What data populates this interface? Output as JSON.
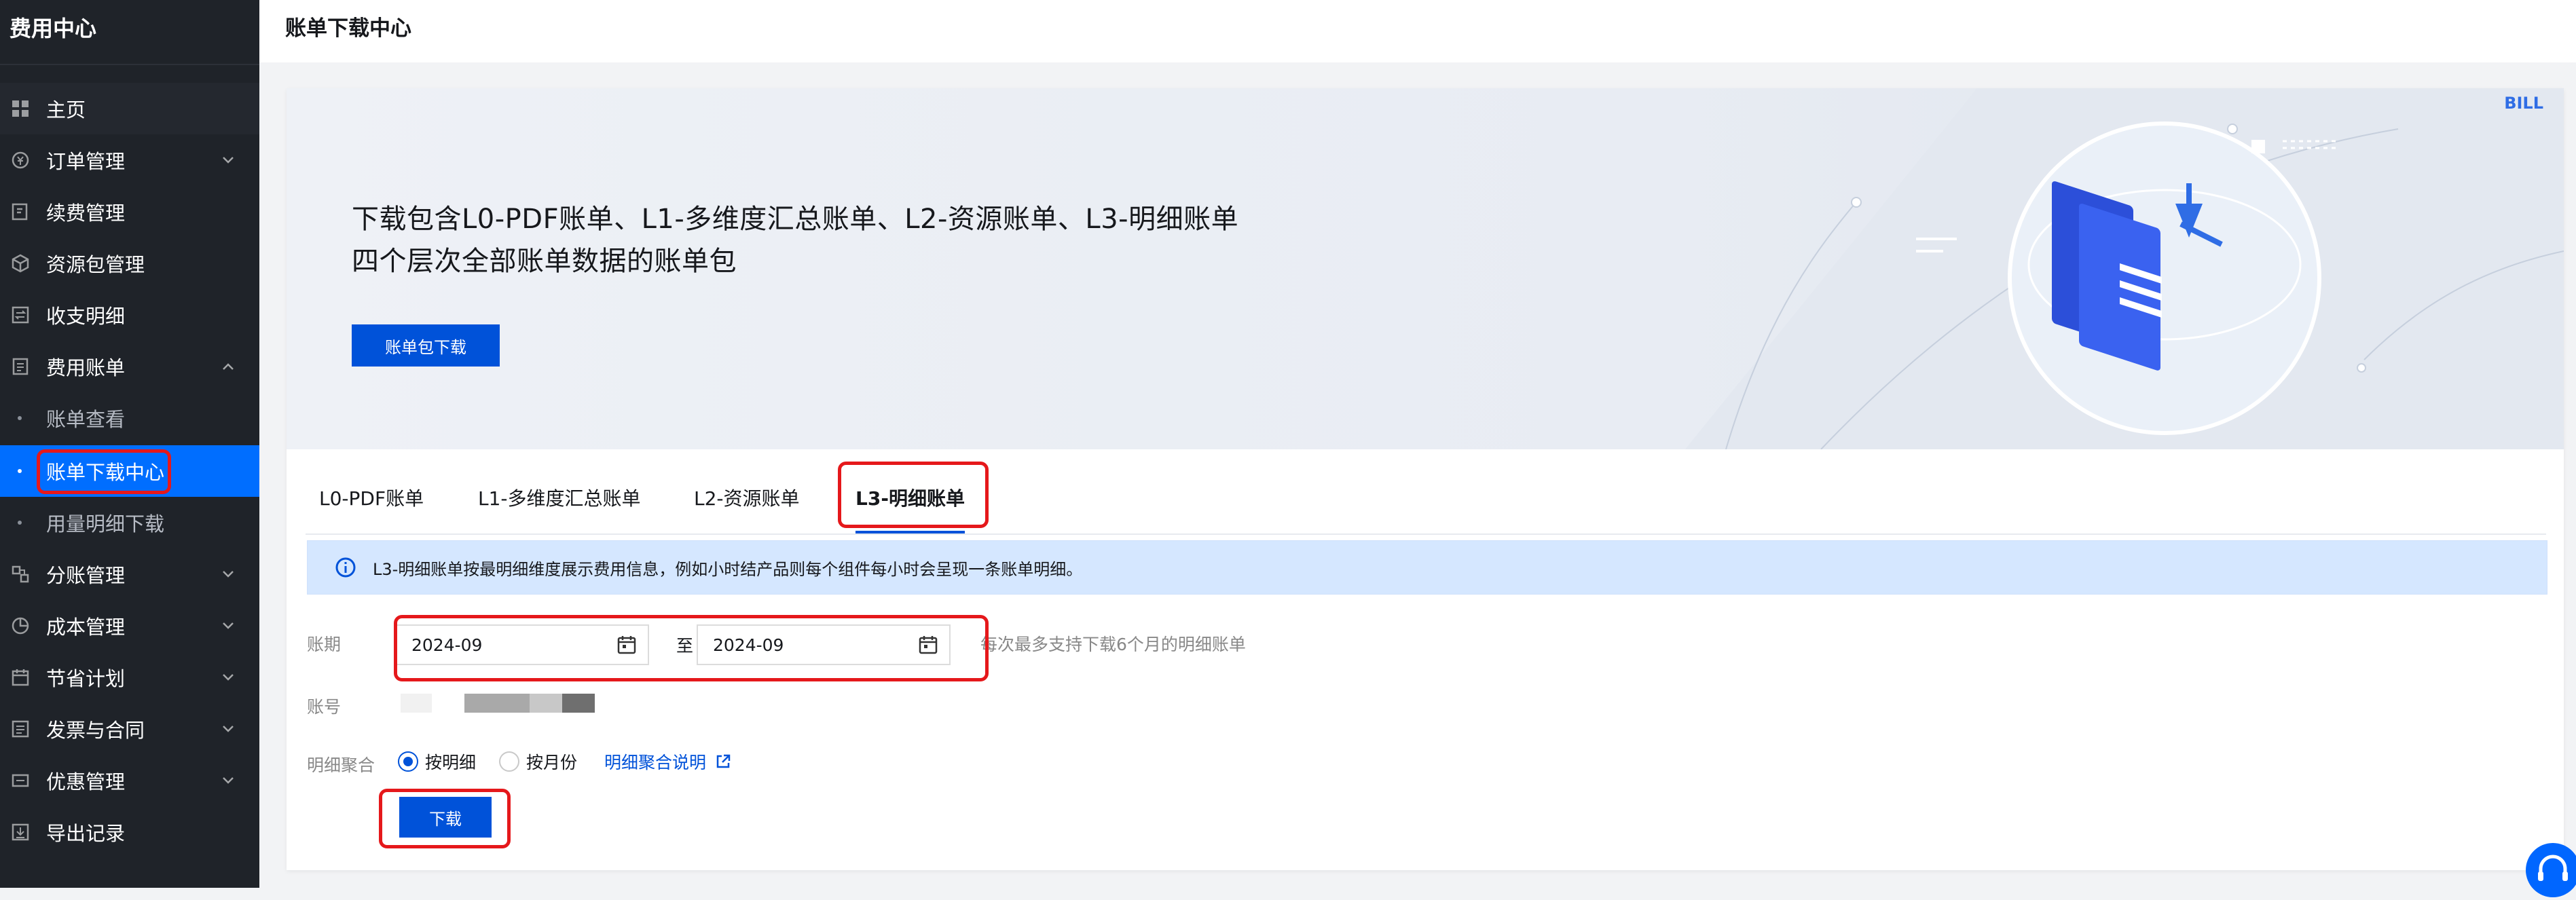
{
  "sidebar": {
    "brand": "费用中心",
    "items": [
      {
        "label": "主页",
        "icon": "grid-icon"
      },
      {
        "label": "订单管理",
        "icon": "order-icon",
        "expandable": true
      },
      {
        "label": "续费管理",
        "icon": "renew-icon"
      },
      {
        "label": "资源包管理",
        "icon": "package-icon"
      },
      {
        "label": "收支明细",
        "icon": "transfer-icon"
      },
      {
        "label": "费用账单",
        "icon": "bill-icon",
        "expandable": true,
        "expanded": true
      },
      {
        "label": "账单查看",
        "sub": true
      },
      {
        "label": "账单下载中心",
        "sub": true,
        "active": true
      },
      {
        "label": "用量明细下载",
        "sub": true
      },
      {
        "label": "分账管理",
        "icon": "split-icon",
        "expandable": true
      },
      {
        "label": "成本管理",
        "icon": "pie-icon",
        "expandable": true
      },
      {
        "label": "节省计划",
        "icon": "calendar-icon",
        "expandable": true
      },
      {
        "label": "发票与合同",
        "icon": "invoice-icon",
        "expandable": true
      },
      {
        "label": "优惠管理",
        "icon": "coupon-icon",
        "expandable": true
      },
      {
        "label": "导出记录",
        "icon": "export-icon"
      }
    ]
  },
  "header": {
    "title": "账单下载中心"
  },
  "banner": {
    "line1": "下载包含L0-PDF账单、L1-多维度汇总账单、L2-资源账单、L3-明细账单",
    "line2": "四个层次全部账单数据的账单包",
    "button": "账单包下载",
    "badge": "BILL"
  },
  "tabs": [
    {
      "label": "L0-PDF账单"
    },
    {
      "label": "L1-多维度汇总账单"
    },
    {
      "label": "L2-资源账单"
    },
    {
      "label": "L3-明细账单",
      "active": true
    }
  ],
  "alert": {
    "text": "L3-明细账单按最明细维度展示费用信息，例如小时结产品则每个组件每小时会呈现一条账单明细。"
  },
  "form": {
    "period_label": "账期",
    "start": "2024-09",
    "to": "至",
    "end": "2024-09",
    "hint": "每次最多支持下载6个月的明细账单",
    "account_label": "账号",
    "agg_label": "明细聚合",
    "radio_detail": "按明细",
    "radio_month": "按月份",
    "agg_link": "明细聚合说明",
    "download": "下载"
  },
  "colors": {
    "primary": "#0052d9",
    "active_nav": "#006eff",
    "highlight": "#e5181b",
    "sidebar_bg": "#1f2329"
  }
}
